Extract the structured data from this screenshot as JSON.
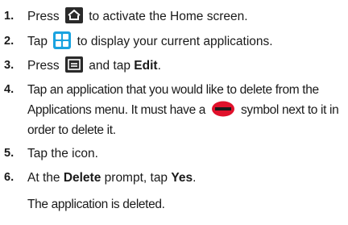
{
  "steps": [
    {
      "num": "1.",
      "before": "Press",
      "after": "to activate the Home screen.",
      "icon": "home-key-icon"
    },
    {
      "num": "2.",
      "before": "Tap",
      "after": "to display your current applications.",
      "icon": "apps-grid-icon"
    },
    {
      "num": "3.",
      "before": "Press",
      "mid": "and tap",
      "bold": "Edit",
      "end": ".",
      "icon": "menu-key-icon"
    },
    {
      "num": "4.",
      "line1": "Tap an application that you would like to delete from the",
      "line2_before": "Applications menu. It must have a",
      "line2_after": "symbol next to it in",
      "line3": "order to delete it.",
      "icon": "remove-symbol-icon"
    },
    {
      "num": "5.",
      "text": "Tap the icon."
    },
    {
      "num": "6.",
      "before": "At the",
      "bold1": "Delete",
      "mid": "prompt, tap",
      "bold2": "Yes",
      "end": "."
    }
  ],
  "result": "The application is deleted.",
  "colors": {
    "text": "#1a1a1a",
    "icon_dark": "#2a2a2a",
    "icon_blue": "#1aa3e0",
    "remove_red": "#e0112b"
  }
}
